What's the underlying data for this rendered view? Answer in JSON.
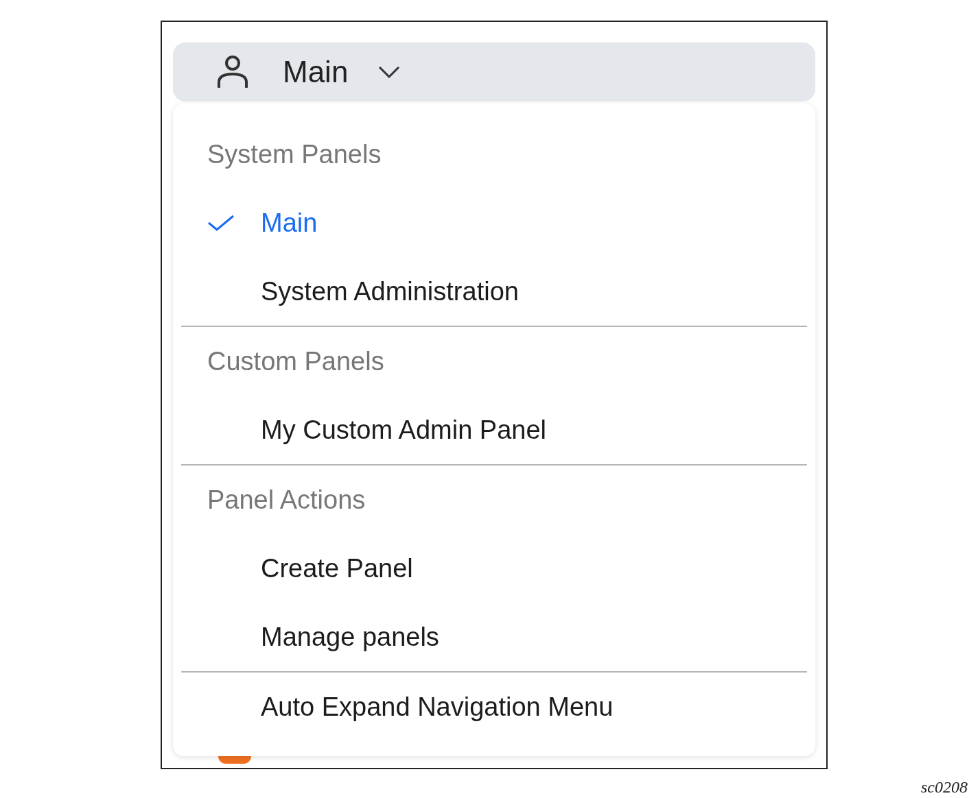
{
  "button": {
    "label": "Main",
    "expanded": true
  },
  "menu": {
    "sections": [
      {
        "heading": "System Panels",
        "items": [
          {
            "label": "Main",
            "selected": true
          },
          {
            "label": "System Administration",
            "selected": false
          }
        ]
      },
      {
        "heading": "Custom Panels",
        "items": [
          {
            "label": "My Custom Admin Panel",
            "selected": false
          }
        ]
      },
      {
        "heading": "Panel Actions",
        "items": [
          {
            "label": "Create Panel",
            "selected": false
          },
          {
            "label": "Manage panels",
            "selected": false
          }
        ]
      },
      {
        "items": [
          {
            "label": "Auto Expand Navigation Menu",
            "selected": false
          }
        ]
      }
    ]
  },
  "figure_id": "sc0208"
}
